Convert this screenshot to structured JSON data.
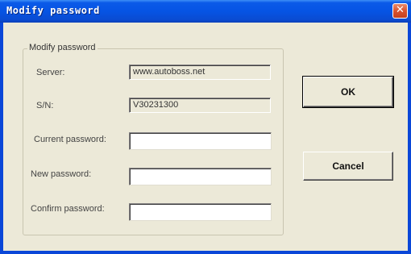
{
  "window": {
    "title": "Modify password",
    "close_symbol": "✕"
  },
  "group": {
    "label": "Modify password"
  },
  "fields": {
    "server": {
      "label": "Server:",
      "value": "www.autoboss.net"
    },
    "sn": {
      "label": "S/N:",
      "value": "V30231300"
    },
    "current_password": {
      "label": "Current password:",
      "value": ""
    },
    "new_password": {
      "label": "New password:",
      "value": ""
    },
    "confirm_password": {
      "label": "Confirm password:",
      "value": ""
    }
  },
  "buttons": {
    "ok": "OK",
    "cancel": "Cancel"
  },
  "icons": {
    "close": "close-icon"
  },
  "colors": {
    "titlebar": "#0654e4",
    "dialog_bg": "#ece9d8",
    "close_button": "#d8532f"
  }
}
